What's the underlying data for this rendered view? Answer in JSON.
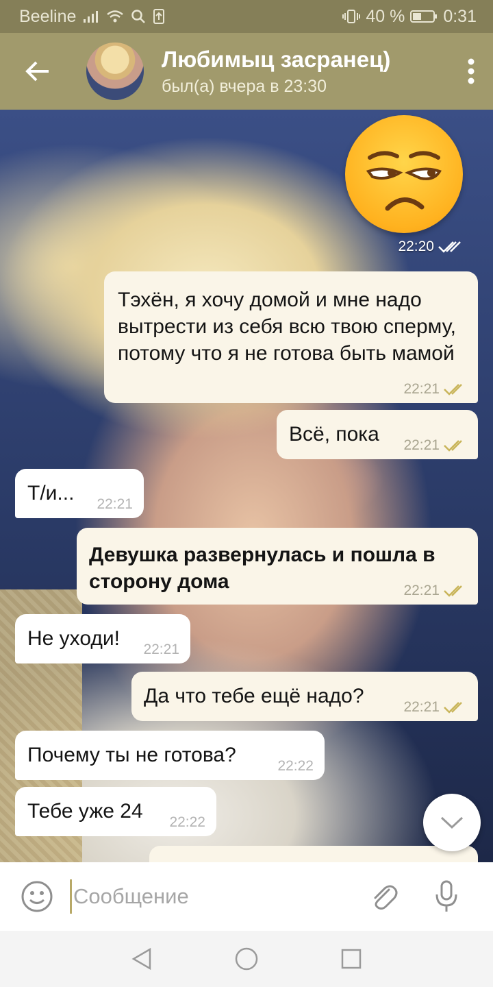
{
  "status_bar": {
    "carrier": "Beeline",
    "battery_percent": "40 %",
    "time": "0:31"
  },
  "header": {
    "contact_name": "Любимыц засранец)",
    "last_seen": "был(а) вчера в 23:30"
  },
  "emoji_message": {
    "emoji": "unamused-face",
    "time": "22:20"
  },
  "messages": [
    {
      "direction": "out",
      "text": "Тэхён, я хочу домой и мне надо вытрести из себя всю твою сперму, потому что я не готова быть мамой",
      "time": "22:21"
    },
    {
      "direction": "out",
      "text": "Всё, пока",
      "time": "22:21"
    },
    {
      "direction": "in",
      "text": "Т/и...",
      "time": "22:21"
    },
    {
      "direction": "out",
      "text": "Девушка развернулась и пошла в сторону дома",
      "time": "22:21",
      "bold": true
    },
    {
      "direction": "in",
      "text": "Не уходи!",
      "time": "22:21"
    },
    {
      "direction": "out",
      "text": "Да что тебе ещё надо?",
      "time": "22:21"
    },
    {
      "direction": "in",
      "text": "Почему ты не готова?",
      "time": "22:22"
    },
    {
      "direction": "in",
      "text": "Тебе уже 24",
      "time": "22:22"
    }
  ],
  "input": {
    "placeholder": "Сообщение"
  },
  "colors": {
    "header_bg": "#a19a6c",
    "status_bg": "#857f58",
    "outgoing_bubble": "#faf5e8",
    "incoming_bubble": "#ffffff",
    "check_color": "#c9b55a"
  }
}
